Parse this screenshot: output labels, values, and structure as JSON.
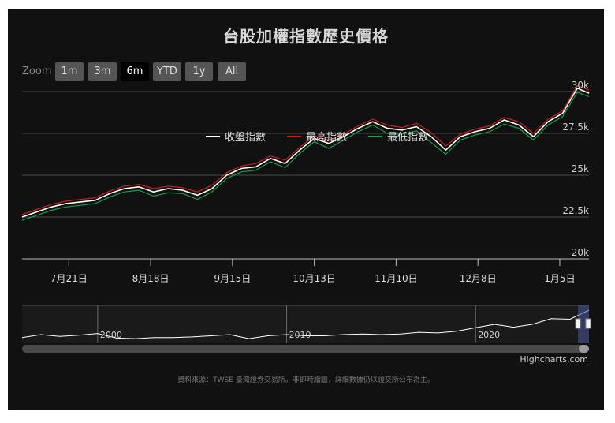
{
  "title": "台股加權指數歷史價格",
  "zoom": {
    "label": "Zoom",
    "buttons": [
      "1m",
      "3m",
      "6m",
      "YTD",
      "1y",
      "All"
    ],
    "selected": "6m"
  },
  "legend": {
    "items": [
      {
        "name": "收盤指數",
        "color": "#ffffff"
      },
      {
        "name": "最高指數",
        "color": "#cc1f1f"
      },
      {
        "name": "最低指數",
        "color": "#1e9c4a"
      }
    ]
  },
  "chart_data": {
    "type": "line",
    "title": "台股加權指數歷史價格",
    "x_tick_labels": [
      "7月21日",
      "8月18日",
      "9月15日",
      "10月13日",
      "11月10日",
      "12月8日",
      "1月5日"
    ],
    "y_tick_labels": [
      "20k",
      "22.5k",
      "25k",
      "27.5k",
      "30k"
    ],
    "ylim": [
      20000,
      30000
    ],
    "x_range_days": [
      0,
      194
    ],
    "x_tick_days": [
      16,
      44,
      72,
      100,
      128,
      156,
      184
    ],
    "grid": true,
    "legend_position": "top-center",
    "series": [
      {
        "name": "收盤指數",
        "color": "#ffffff",
        "x": [
          0,
          5,
          10,
          15,
          20,
          25,
          30,
          35,
          40,
          45,
          50,
          55,
          60,
          65,
          70,
          75,
          80,
          85,
          90,
          95,
          100,
          105,
          110,
          115,
          120,
          125,
          130,
          135,
          140,
          145,
          150,
          155,
          160,
          165,
          170,
          175,
          180,
          185,
          190,
          194
        ],
        "values": [
          22500,
          22800,
          23100,
          23300,
          23400,
          23500,
          23900,
          24200,
          24300,
          24000,
          24200,
          24100,
          23800,
          24200,
          25000,
          25400,
          25500,
          26000,
          25700,
          26500,
          27200,
          26900,
          27300,
          27800,
          28200,
          27800,
          27700,
          27900,
          27300,
          26500,
          27300,
          27600,
          27800,
          28300,
          28000,
          27300,
          28200,
          28700,
          30200,
          29900
        ]
      },
      {
        "name": "最高指數",
        "color": "#cc1f1f",
        "x": [
          0,
          5,
          10,
          15,
          20,
          25,
          30,
          35,
          40,
          45,
          50,
          55,
          60,
          65,
          70,
          75,
          80,
          85,
          90,
          95,
          100,
          105,
          110,
          115,
          120,
          125,
          130,
          135,
          140,
          145,
          150,
          155,
          160,
          165,
          170,
          175,
          180,
          185,
          190,
          194
        ],
        "values": [
          22650,
          22950,
          23250,
          23450,
          23550,
          23650,
          24050,
          24350,
          24450,
          24200,
          24350,
          24250,
          24000,
          24400,
          25150,
          25550,
          25700,
          26150,
          25900,
          26650,
          27350,
          27100,
          27450,
          27950,
          28350,
          28000,
          27850,
          28100,
          27550,
          26750,
          27450,
          27750,
          27950,
          28450,
          28200,
          27500,
          28350,
          28850,
          30350,
          30100
        ]
      },
      {
        "name": "最低指數",
        "color": "#1e9c4a",
        "x": [
          0,
          5,
          10,
          15,
          20,
          25,
          30,
          35,
          40,
          45,
          50,
          55,
          60,
          65,
          70,
          75,
          80,
          85,
          90,
          95,
          100,
          105,
          110,
          115,
          120,
          125,
          130,
          135,
          140,
          145,
          150,
          155,
          160,
          165,
          170,
          175,
          180,
          185,
          190,
          194
        ],
        "values": [
          22300,
          22600,
          22900,
          23100,
          23200,
          23300,
          23700,
          24000,
          24100,
          23750,
          23950,
          23900,
          23550,
          24000,
          24800,
          25200,
          25300,
          25800,
          25450,
          26300,
          27000,
          26600,
          27100,
          27600,
          28000,
          27500,
          27450,
          27650,
          26950,
          26250,
          27100,
          27400,
          27600,
          28050,
          27800,
          27100,
          28000,
          28500,
          29950,
          29700
        ]
      }
    ]
  },
  "navigator": {
    "labels": [
      "2000",
      "2010",
      "2020"
    ],
    "x_years": [
      1996,
      2026
    ],
    "label_years": [
      2000,
      2010,
      2020
    ],
    "ylim": [
      3000,
      32000
    ],
    "years": [
      1996,
      1997,
      1998,
      1999,
      2000,
      2001,
      2002,
      2003,
      2004,
      2005,
      2006,
      2007,
      2008,
      2009,
      2010,
      2011,
      2012,
      2013,
      2014,
      2015,
      2016,
      2017,
      2018,
      2019,
      2020,
      2021,
      2022,
      2023,
      2024,
      2025,
      2026
    ],
    "values": [
      6000,
      8500,
      7000,
      8000,
      9500,
      5500,
      5000,
      6000,
      6000,
      6500,
      7500,
      8500,
      5000,
      7500,
      8500,
      7500,
      7500,
      8500,
      9000,
      8500,
      9000,
      10500,
      10000,
      11500,
      14500,
      17500,
      15000,
      17500,
      22500,
      22000,
      30000
    ]
  },
  "credits": "Highcharts.com",
  "source_note": "資料來源：TWSE 臺灣證券交易所。非即時繪圖，詳細數據仍以證交所公布為主。"
}
